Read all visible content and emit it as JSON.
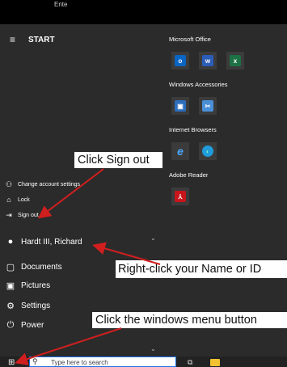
{
  "window": {
    "caption": "Ente"
  },
  "start_menu": {
    "title": "START",
    "account_menu": [
      {
        "label": "Change account settings",
        "icon": "person-key-icon"
      },
      {
        "label": "Lock",
        "icon": "lock-icon"
      },
      {
        "label": "Sign out",
        "icon": "sign-out-icon"
      }
    ],
    "user": {
      "name": "Hardt III, Richard",
      "icon": "avatar-icon"
    },
    "items": [
      {
        "label": "Documents",
        "icon": "document-icon"
      },
      {
        "label": "Pictures",
        "icon": "picture-icon"
      },
      {
        "label": "Settings",
        "icon": "gear-icon"
      },
      {
        "label": "Power",
        "icon": "power-icon"
      }
    ]
  },
  "tile_groups": [
    {
      "title": "Microsoft Office",
      "tiles": [
        {
          "name": "outlook-tile",
          "glyph": "o",
          "color": "#0a64c2"
        },
        {
          "name": "word-tile",
          "glyph": "w",
          "color": "#2b5cb8"
        },
        {
          "name": "excel-tile",
          "glyph": "x",
          "color": "#1e7145"
        }
      ]
    },
    {
      "title": "Windows Accessories",
      "tiles": [
        {
          "name": "remote-desktop-tile",
          "glyph": "▣",
          "color": "#2d6ebd"
        },
        {
          "name": "snipping-tool-tile",
          "glyph": "✂",
          "color": "#4a90d9"
        }
      ]
    },
    {
      "title": "Internet Browsers",
      "tiles": [
        {
          "name": "internet-explorer-tile",
          "glyph": "e",
          "color": "#3c3c3c"
        },
        {
          "name": "edge-tile",
          "glyph": "◐",
          "color": "#1f9cd9"
        }
      ]
    },
    {
      "title": "Adobe Reader",
      "tiles": [
        {
          "name": "adobe-reader-tile",
          "glyph": "⅄",
          "color": "#c8151b"
        }
      ]
    }
  ],
  "taskbar": {
    "search_placeholder": "Type here to search"
  },
  "callouts": {
    "sign_out": "Click Sign out",
    "name_or_id": "Right-click your Name or ID",
    "windows_menu": "Click the windows menu button"
  },
  "colors": {
    "arrow": "#d11f1f",
    "menu_bg": "#2b2b2b",
    "search_border": "#1a73e8"
  }
}
